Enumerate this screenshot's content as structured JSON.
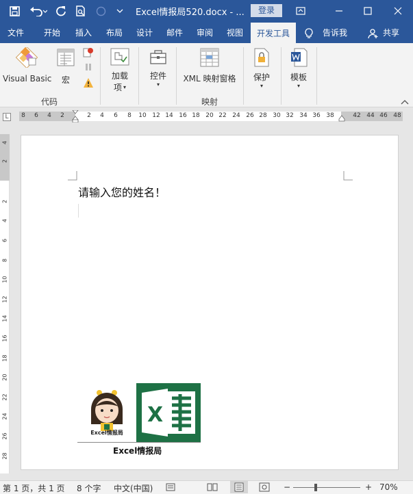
{
  "titlebar": {
    "title": "Excel情报局520.docx  -  ...",
    "login_label": "登录",
    "quick_access": [
      "save-icon",
      "undo-icon",
      "redo-icon",
      "print-preview-icon",
      "touch-mode-icon",
      "customize-icon"
    ],
    "window_buttons": [
      "ribbon-options-icon",
      "minimize-icon",
      "maximize-icon",
      "close-icon"
    ]
  },
  "tabs": [
    {
      "label": "文件"
    },
    {
      "label": "开始"
    },
    {
      "label": "插入"
    },
    {
      "label": "布局"
    },
    {
      "label": "设计"
    },
    {
      "label": "邮件"
    },
    {
      "label": "审阅"
    },
    {
      "label": "视图"
    },
    {
      "label": "开发工具",
      "active": true
    },
    {
      "label": "告诉我"
    },
    {
      "label": "共享"
    }
  ],
  "ribbon": {
    "visual_basic": "Visual Basic",
    "macro": "宏",
    "group_code": "代码",
    "addins_line1": "加载",
    "addins_line2": "项",
    "controls": "控件",
    "xml_mapping": "XML 映射窗格",
    "group_mapping": "映射",
    "protect": "保护",
    "template": "模板"
  },
  "ruler": {
    "h_left_numbers": [
      "8",
      "6",
      "4",
      "2"
    ],
    "h_numbers": [
      "2",
      "4",
      "6",
      "8",
      "10",
      "12",
      "14",
      "16",
      "18",
      "20",
      "22",
      "24",
      "26",
      "28",
      "30",
      "32",
      "34",
      "36",
      "38"
    ],
    "h_right_numbers": [
      "42",
      "44",
      "46",
      "48"
    ],
    "v_numbers": [
      "4",
      "2",
      "2",
      "4",
      "6",
      "8",
      "10",
      "12",
      "14",
      "16",
      "18",
      "20",
      "22",
      "24",
      "26",
      "28"
    ],
    "corner_symbol": "L"
  },
  "document": {
    "text": "请输入您的姓名！",
    "logo_caption": "Excel情报局",
    "mascot_caption": "Excel情报局",
    "excel_letter": "X"
  },
  "status": {
    "page": "第 1 页，共 1 页",
    "words": "8 个字",
    "language": "中文(中国)",
    "zoom_minus": "−",
    "zoom_plus": "+",
    "zoom": "70%",
    "zoom_level": 0.7
  },
  "colors": {
    "word_blue": "#2b579a",
    "excel_green": "#1e7145",
    "ribbon_bg": "#f3f3f3"
  }
}
